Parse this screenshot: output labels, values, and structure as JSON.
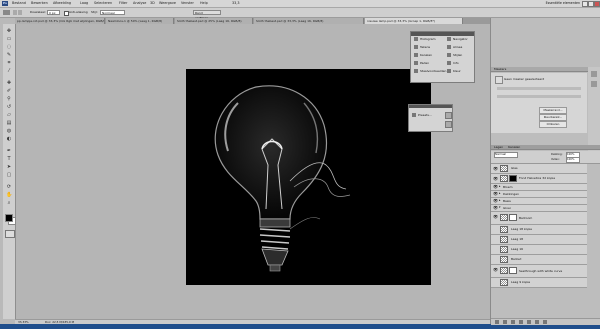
{
  "menubar": {
    "app_logo": "Ps",
    "items": [
      "Bestand",
      "Bewerken",
      "Afbeelding",
      "Laag",
      "Selecteren",
      "Filter",
      "Analyse",
      "3D",
      "Weergave",
      "Venster",
      "Help"
    ],
    "zoom": "33,3",
    "workspace": "Essentiële elementen"
  },
  "options": {
    "feather_label": "Doezelaar:",
    "feather_value": "0 px",
    "antialias_label": "Anti-aliasing",
    "style_label": "Stijl:",
    "style_value": "Normaal",
    "refine_label": "Rand verfijnen..."
  },
  "tabs": [
    "pp-lampje-rot.psd @ 33,3% (Ooi Rgb met wijzingen, RGB/8*)",
    "Naamloos-1 @ 50% (Laag 1, RGB/8)",
    "Sloth thebest.psd @ 25% (Laag 16, RGB/8)",
    "Sloth thebest.psd @ 33,3% (Laag 16, RGB/8)",
    "nieuwe lamp.psd @ 33,3% (Groep 1, RGB/8*)"
  ],
  "status": {
    "zoom": "33,33%",
    "doc": "Doc: 22,5 M/435,9 M"
  },
  "tools_panel": {
    "items": [
      {
        "label": "Histogram",
        "icon": "histogram-icon"
      },
      {
        "label": "Navigator",
        "icon": "navigator-icon"
      },
      {
        "label": "Tekens",
        "icon": "type-icon"
      },
      {
        "label": "Alinea",
        "icon": "paragraph-icon"
      },
      {
        "label": "Kanalen",
        "icon": "channels-icon"
      },
      {
        "label": "Stijlen",
        "icon": "styles-icon"
      },
      {
        "label": "Paden",
        "icon": "paths-icon"
      },
      {
        "label": "Info",
        "icon": "info-icon"
      },
      {
        "label": "Staalvoorbeelden",
        "icon": "swatches-icon"
      },
      {
        "label": "Kleur",
        "icon": "color-icon"
      }
    ]
  },
  "presets_panel": {
    "label": "Presets..."
  },
  "masks_panel": {
    "title": "Maskers",
    "message": "Geen masker geselecteerd",
    "buttons": [
      "Maskerrand...",
      "Kleurbereik...",
      "Omkeren"
    ]
  },
  "layers_panel": {
    "tabs": [
      "Lagen",
      "Kanalen"
    ],
    "blend_mode": "Normaal",
    "opacity_label": "Dekking:",
    "opacity_value": "100%",
    "fill_label": "Vullen:",
    "fill_value": "100%",
    "layers": [
      {
        "name": "Glas",
        "group": false,
        "visible": true,
        "mask": false
      },
      {
        "name": "Fond Helvetica 3d kopie",
        "group": false,
        "visible": true,
        "mask": true
      },
      {
        "name": "Bloem",
        "group": true,
        "visible": true,
        "mask": false
      },
      {
        "name": "Dekkingen",
        "group": true,
        "visible": true,
        "mask": false
      },
      {
        "name": "Basis",
        "group": true,
        "visible": true,
        "mask": false
      },
      {
        "name": "Gloei",
        "group": true,
        "visible": true,
        "mask": false
      },
      {
        "name": "Ballroom",
        "group": false,
        "visible": true,
        "mask": true
      },
      {
        "name": "Laag 18 kopie",
        "group": false,
        "visible": false,
        "mask": false
      },
      {
        "name": "Laag 18",
        "group": false,
        "visible": false,
        "mask": false
      },
      {
        "name": "Laag 16",
        "group": false,
        "visible": false,
        "mask": false
      },
      {
        "name": "Ballout",
        "group": false,
        "visible": false,
        "mask": false
      },
      {
        "name": "Seethrough with white curve",
        "group": false,
        "visible": true,
        "mask": true
      },
      {
        "name": "Laag 9 kopie",
        "group": false,
        "visible": false,
        "mask": false
      }
    ]
  },
  "colors": {
    "foreground": "#000000",
    "background": "#ffffff"
  }
}
